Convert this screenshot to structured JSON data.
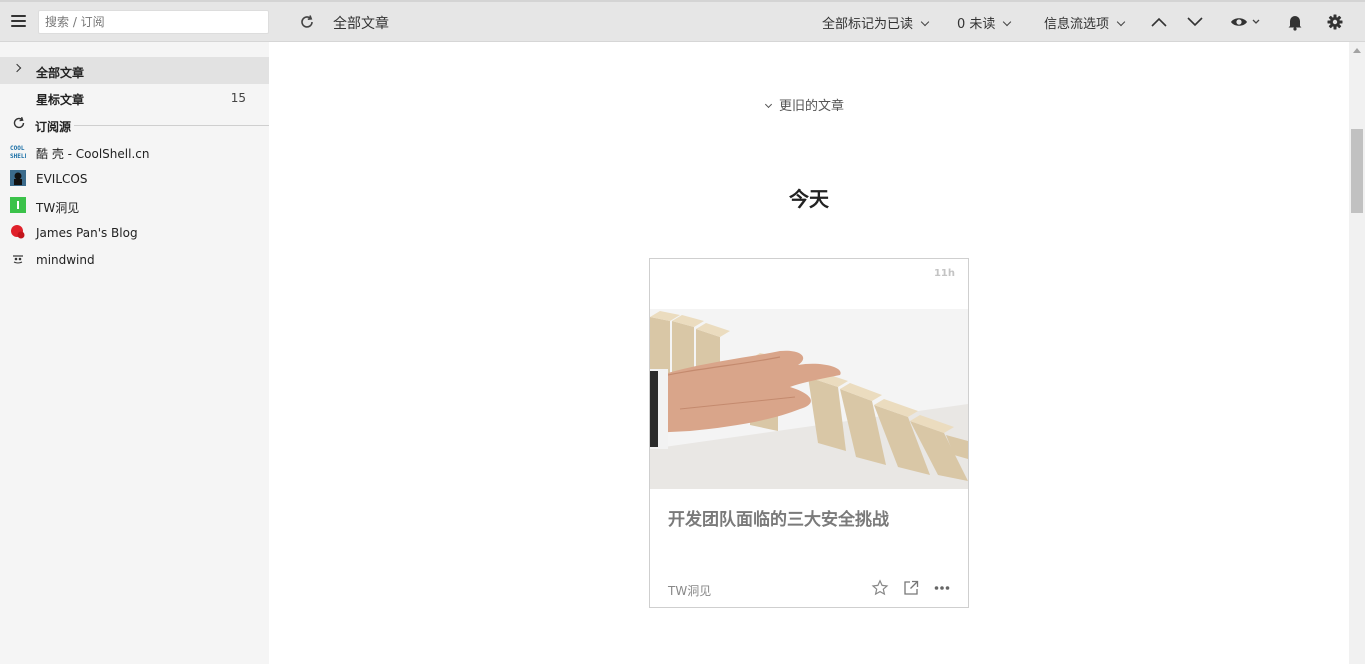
{
  "search": {
    "placeholder": "搜索 / 订阅"
  },
  "header": {
    "title": "全部文章",
    "mark_all_read": "全部标记为已读",
    "unread": "0 未读",
    "feed_options": "信息流选项"
  },
  "sidebar": {
    "all_articles": "全部文章",
    "starred": {
      "label": "星标文章",
      "count": "15"
    },
    "feeds_heading": "订阅源",
    "feeds": [
      {
        "label": "酷 壳 - CoolShell.cn",
        "icon": "coolshell-icon"
      },
      {
        "label": "EVILCOS",
        "icon": "evilcos-icon"
      },
      {
        "label": "TW洞见",
        "icon": "tw-icon"
      },
      {
        "label": "James Pan's Blog",
        "icon": "james-pan-icon"
      },
      {
        "label": "mindwind",
        "icon": "mindwind-icon"
      }
    ]
  },
  "main": {
    "older_articles": "更旧的文章",
    "day_heading": "今天",
    "card": {
      "age": "11h",
      "title": "开发团队面临的三大安全挑战",
      "source": "TW洞见"
    }
  },
  "colors": {
    "topbar": "#e6e6e6",
    "sidebar": "#f5f5f5",
    "active_row": "#e2e2e2"
  }
}
